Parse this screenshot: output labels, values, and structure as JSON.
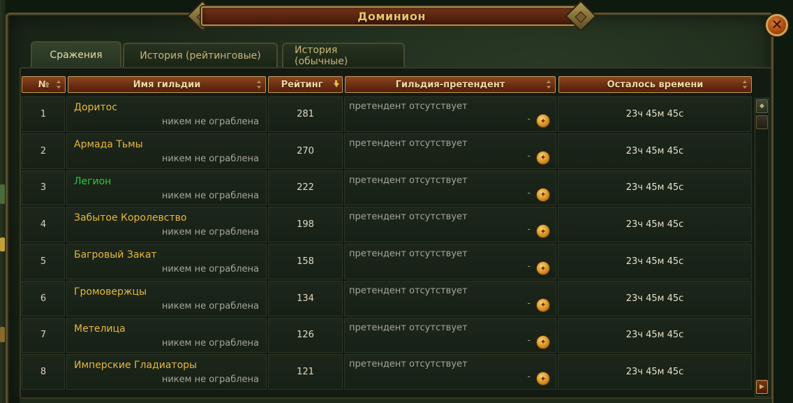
{
  "window": {
    "title": "Доминион",
    "close_icon_glyph": "✕"
  },
  "tabs": [
    {
      "label": "Сражения",
      "active": true
    },
    {
      "label": "История (рейтинговые)",
      "active": false
    },
    {
      "label": "История (обычные)",
      "active": false
    }
  ],
  "columns": {
    "number": "№",
    "guild_name": "Имя гильдии",
    "rating": "Рейтинг",
    "challenger": "Гильдия-претендент",
    "time_left": "Осталось времени"
  },
  "sort": {
    "column": "rating",
    "direction": "desc"
  },
  "rows": [
    {
      "num": "1",
      "guild": "Доритос",
      "guild_color": "#e8b838",
      "status": "никем не ограблена",
      "rating": "281",
      "challenger": "претендент отсутствует",
      "dash": "-",
      "time": "23ч 45м 45с"
    },
    {
      "num": "2",
      "guild": "Армада Тьмы",
      "guild_color": "#e8b838",
      "status": "никем не ограблена",
      "rating": "270",
      "challenger": "претендент отсутствует",
      "dash": "-",
      "time": "23ч 45м 45с"
    },
    {
      "num": "3",
      "guild": "Легион",
      "guild_color": "#2ec83a",
      "status": "никем не ограблена",
      "rating": "222",
      "challenger": "претендент отсутствует",
      "dash": "-",
      "time": "23ч 45м 45с"
    },
    {
      "num": "4",
      "guild": "Забытое Королевство",
      "guild_color": "#e8b838",
      "status": "никем не ограблена",
      "rating": "198",
      "challenger": "претендент отсутствует",
      "dash": "-",
      "time": "23ч 45м 45с"
    },
    {
      "num": "5",
      "guild": "Багровый Закат",
      "guild_color": "#e8b838",
      "status": "никем не ограблена",
      "rating": "158",
      "challenger": "претендент отсутствует",
      "dash": "-",
      "time": "23ч 45м 45с"
    },
    {
      "num": "6",
      "guild": "Громовержцы",
      "guild_color": "#e8b838",
      "status": "никем не ограблена",
      "rating": "134",
      "challenger": "претендент отсутствует",
      "dash": "-",
      "time": "23ч 45м 45с"
    },
    {
      "num": "7",
      "guild": "Метелица",
      "guild_color": "#e8b838",
      "status": "никем не ограблена",
      "rating": "126",
      "challenger": "претендент отсутствует",
      "dash": "-",
      "time": "23ч 45м 45с"
    },
    {
      "num": "8",
      "guild": "Имперские Гладиаторы",
      "guild_color": "#e8b838",
      "status": "никем не ограблена",
      "rating": "121",
      "challenger": "претендент отсутствует",
      "dash": "-",
      "time": "23ч 45м 45с"
    }
  ],
  "icons": {
    "coin": "gold-coin-icon",
    "sort": "sort-arrows-icon",
    "close": "close-icon"
  },
  "colors": {
    "accent_gold": "#e8b838",
    "highlight_green": "#2ec83a",
    "header_red": "#6a2e12"
  }
}
